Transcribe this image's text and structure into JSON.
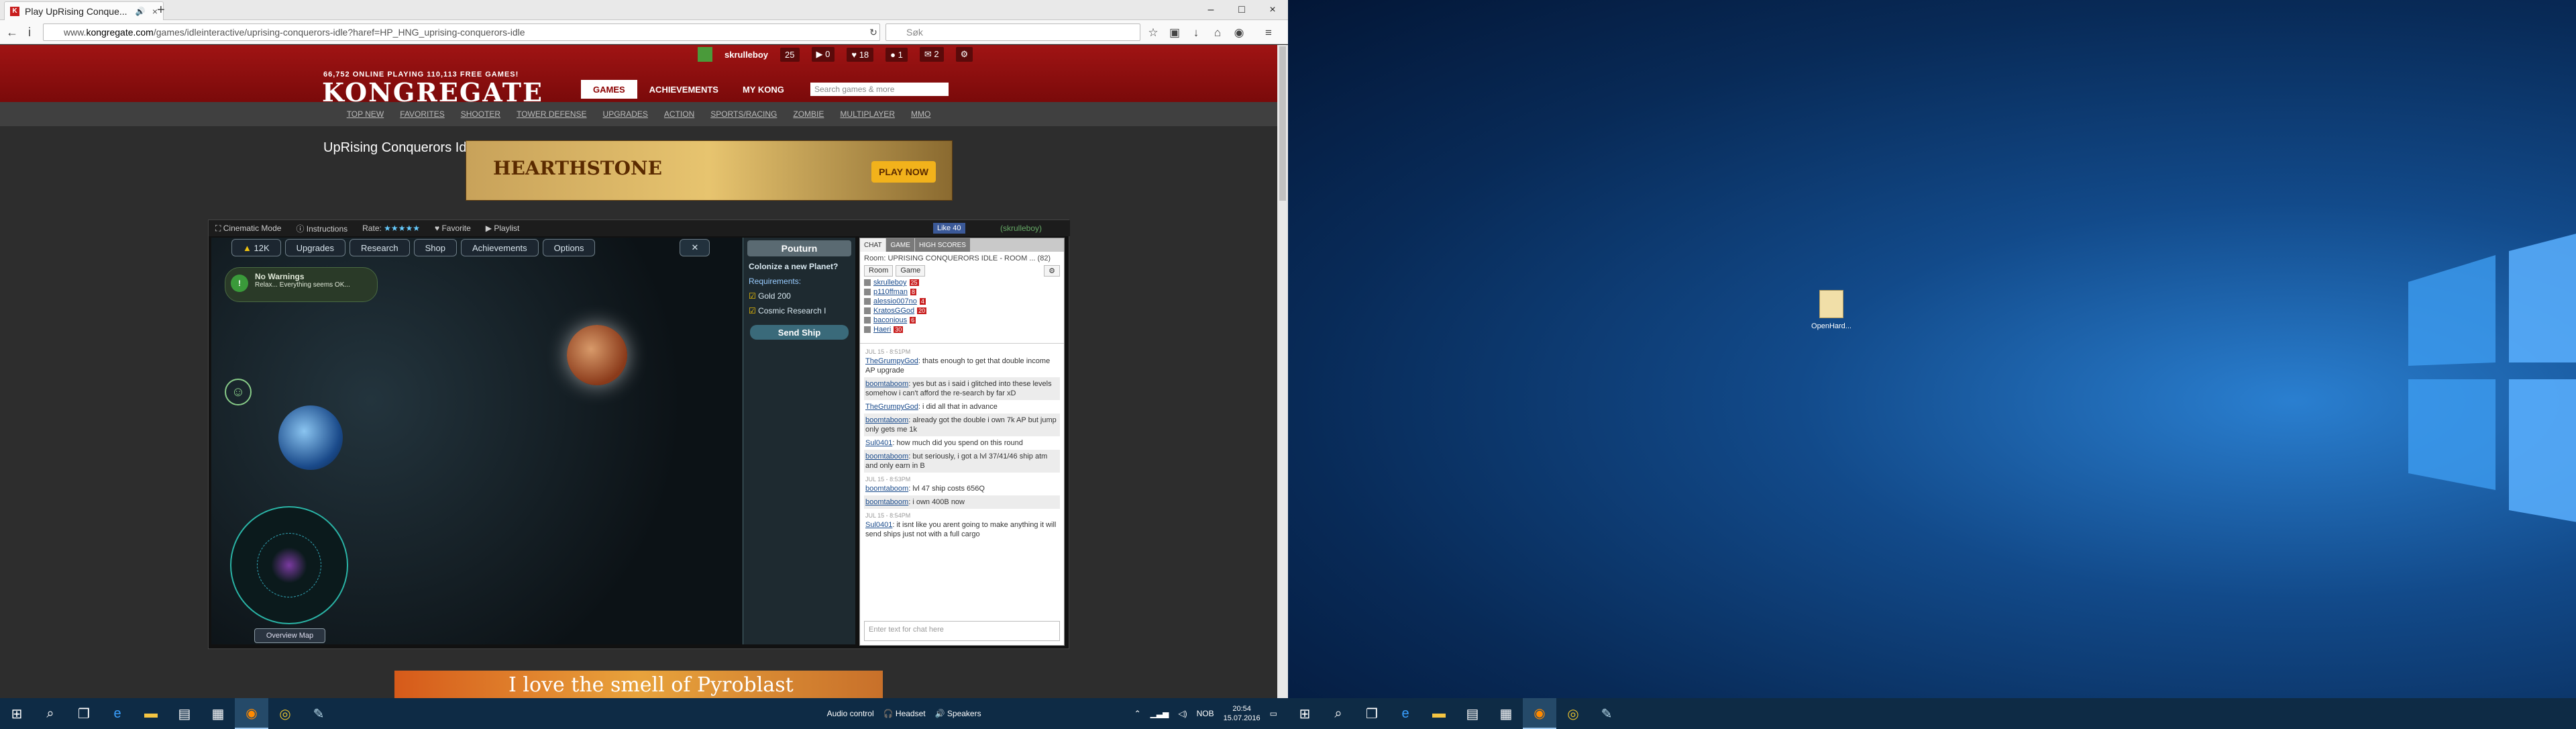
{
  "browser": {
    "tab_title": "Play UpRising Conque...",
    "url_prefix": "www.",
    "url_domain": "kongregate.com",
    "url_path": "/games/idleinteractive/uprising-conquerors-idle?haref=HP_HNG_uprising-conquerors-idle",
    "search_placeholder": "Søk",
    "toolbar_icons": [
      "star-icon",
      "clipboard-icon",
      "download-icon",
      "home-icon",
      "pocket-icon",
      "menu-icon"
    ]
  },
  "kong": {
    "online_text": "66,752 ONLINE PLAYING 110,113 FREE GAMES!",
    "logo": "KONGREGATE",
    "username": "skrulleboy",
    "user_level": "25",
    "counters": [
      "0",
      "18",
      "1",
      "2"
    ],
    "main_nav": [
      "GAMES",
      "ACHIEVEMENTS",
      "MY KONG"
    ],
    "search_placeholder": "Search games & more",
    "sub_nav": [
      "TOP NEW",
      "FAVORITES",
      "SHOOTER",
      "TOWER DEFENSE",
      "UPGRADES",
      "ACTION",
      "SPORTS/RACING",
      "ZOMBIE",
      "MULTIPLAYER",
      "MMO"
    ],
    "game_title": "UpRising Conquerors Idle",
    "ad_top_title": "HEARTHSTONE",
    "ad_top_button": "PLAY NOW",
    "ad_bottom_text": "I love the smell of Pyroblast"
  },
  "game_toolbar": {
    "cinematic": "Cinematic Mode",
    "instructions": "Instructions",
    "rate": "Rate:",
    "favorite": "Favorite",
    "playlist": "Playlist",
    "fb_like": "Like",
    "fb_count": "40",
    "status_user": "(skrulleboy)"
  },
  "game": {
    "gold": "12K",
    "tabs": [
      "Upgrades",
      "Research",
      "Shop",
      "Achievements",
      "Options"
    ],
    "warning_title": "No Warnings",
    "warning_sub": "Relax... Everything seems OK...",
    "overview_button": "Overview Map",
    "sidebar_title": "Pouturn",
    "colonize": "Colonize a new Planet?",
    "requirements": "Requirements:",
    "req_gold": "Gold 200",
    "req_research": "Cosmic Research I",
    "send_ship": "Send Ship"
  },
  "chat": {
    "tabs": [
      "CHAT",
      "GAME",
      "HIGH SCORES"
    ],
    "room": "Room: UPRISING CONQUERORS IDLE - ROOM ... (82)",
    "user_tabs": [
      "Room",
      "Game"
    ],
    "users": [
      {
        "name": "skrulleboy",
        "level": "25"
      },
      {
        "name": "p110ffman",
        "level": "8"
      },
      {
        "name": "alessio007no",
        "level": "4"
      },
      {
        "name": "KratosGGod",
        "level": "20"
      },
      {
        "name": "baconious",
        "level": "6"
      },
      {
        "name": "Haeri",
        "level": "30"
      }
    ],
    "messages": [
      {
        "user": "TheGrumpyGod",
        "text": ": thats enough to get that double income AP upgrade",
        "time": "JUL 15 - 8:51PM"
      },
      {
        "user": "boomtaboom",
        "text": ": yes but as i said i glitched into these levels somehow i can't afford the re-search by far xD",
        "time": ""
      },
      {
        "user": "TheGrumpyGod",
        "text": ": i did all that in advance",
        "time": ""
      },
      {
        "user": "boomtaboom",
        "text": ": already got the double i own 7k AP but jump only gets me 1k",
        "time": ""
      },
      {
        "user": "Sul0401",
        "text": ": how much did you spend on this round",
        "time": ""
      },
      {
        "user": "boomtaboom",
        "text": ": but seriously, i got a lvl 37/41/46 ship atm and only earn in B",
        "time": ""
      },
      {
        "user": "boomtaboom",
        "text": ": lvl 47 ship costs 656Q",
        "time": "JUL 15 - 8:53PM"
      },
      {
        "user": "boomtaboom",
        "text": ": i own 400B now",
        "time": ""
      },
      {
        "user": "Sul0401",
        "text": ": it isnt like you arent going to make anything it will send ships just not with a full cargo",
        "time": "JUL 15 - 8:54PM"
      }
    ],
    "input_placeholder": "Enter text for chat here"
  },
  "taskbar_left": {
    "icons": [
      "windows-icon",
      "search-icon",
      "task-view-icon",
      "edge-icon",
      "explorer-icon",
      "store-icon",
      "calculator-icon",
      "firefox-icon",
      "chrome-icon",
      "notepad-icon"
    ],
    "audio_control": "Audio control",
    "headset": "Headset",
    "speakers": "Speakers",
    "lang": "NOB",
    "time": "20:54",
    "date": "15.07.2016"
  },
  "desktop": {
    "file_label": "OpenHard..."
  },
  "colors": {
    "kong_red": "#8b0000",
    "taskbar": "#0e2b45",
    "link_blue": "#1a4b8c"
  }
}
